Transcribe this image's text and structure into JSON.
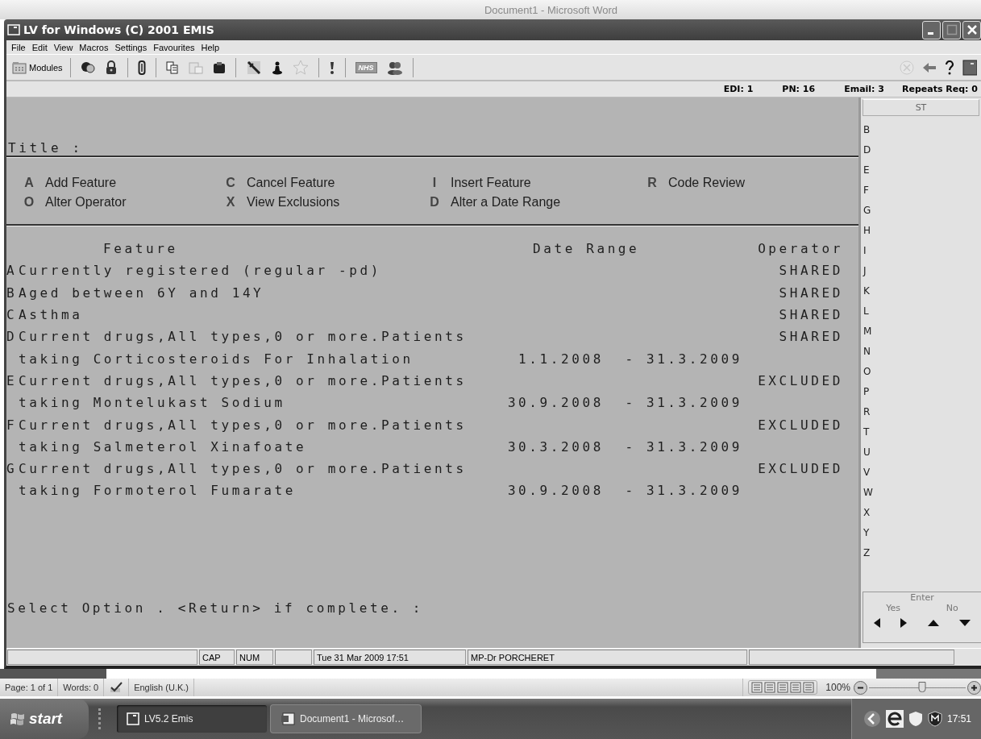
{
  "background_window": {
    "title": "Document1 - Microsoft Word"
  },
  "window": {
    "title": "LV for Windows (C) 2001 EMIS"
  },
  "menu": [
    "File",
    "Edit",
    "View",
    "Macros",
    "Settings",
    "Favourites",
    "Help"
  ],
  "toolbar": {
    "items": [
      {
        "kind": "button",
        "label": "Modules"
      },
      {
        "kind": "separator"
      },
      {
        "kind": "icon",
        "disabled": false
      },
      {
        "kind": "icon",
        "disabled": false
      },
      {
        "kind": "separator"
      },
      {
        "kind": "icon",
        "disabled": false
      },
      {
        "kind": "separator"
      },
      {
        "kind": "icon",
        "disabled": false
      },
      {
        "kind": "icon",
        "disabled": true
      },
      {
        "kind": "icon",
        "disabled": false
      },
      {
        "kind": "separator"
      },
      {
        "kind": "icon",
        "disabled": false
      },
      {
        "kind": "icon",
        "disabled": false
      },
      {
        "kind": "icon",
        "disabled": true
      },
      {
        "kind": "separator"
      },
      {
        "kind": "icon",
        "disabled": false
      },
      {
        "kind": "separator"
      },
      {
        "kind": "badge",
        "label": "NHS",
        "disabled": true
      },
      {
        "kind": "icon",
        "disabled": false
      },
      {
        "kind": "separator"
      }
    ],
    "right": [
      {
        "disabled": true
      },
      {
        "disabled": false
      },
      {
        "disabled": false
      },
      {
        "disabled": false
      }
    ]
  },
  "info_bar": [
    "EDI: 1",
    "PN: 16",
    "Email: 3",
    "Repeats Req: 0"
  ],
  "terminal": {
    "title_label": "Title :",
    "options": [
      {
        "key": "A",
        "label": "Add Feature"
      },
      {
        "key": "C",
        "label": "Cancel Feature"
      },
      {
        "key": "I",
        "label": "Insert Feature"
      },
      {
        "key": "R",
        "label": "Code Review"
      },
      {
        "key": "O",
        "label": "Alter Operator"
      },
      {
        "key": "X",
        "label": "View Exclusions"
      },
      {
        "key": "D",
        "label": "Alter a Date Range"
      }
    ],
    "columns": [
      "Feature",
      "Date Range",
      "Operator"
    ],
    "rows": [
      {
        "letter": "A",
        "feature": "Currently registered (regular -pd)",
        "operator": "SHARED"
      },
      {
        "letter": "B",
        "feature": "Aged between 6Y and 14Y",
        "operator": "SHARED"
      },
      {
        "letter": "C",
        "feature": "Asthma",
        "operator": "SHARED"
      },
      {
        "letter": "D",
        "feature": "Current drugs,All types,0 or more.Patients",
        "detail": "taking Corticosteroids For Inhalation",
        "date_range": "1.1.2008  - 31.3.2009",
        "operator": "SHARED"
      },
      {
        "letter": "E",
        "feature": "Current drugs,All types,0 or more.Patients",
        "detail": "taking Montelukast Sodium",
        "date_range": "30.9.2008  - 31.3.2009",
        "operator": "EXCLUDED"
      },
      {
        "letter": "F",
        "feature": "Current drugs,All types,0 or more.Patients",
        "detail": "taking Salmeterol Xinafoate",
        "date_range": "30.3.2008  - 31.3.2009",
        "operator": "EXCLUDED"
      },
      {
        "letter": "G",
        "feature": "Current drugs,All types,0 or more.Patients",
        "detail": "taking Formoterol Fumarate",
        "date_range": "30.9.2008  - 31.3.2009",
        "operator": "EXCLUDED"
      }
    ],
    "prompt": "Select Option . <Return> if complete. :"
  },
  "sidebar": {
    "header": "ST",
    "letters": [
      "B",
      "D",
      "E",
      "F",
      "G",
      "H",
      "I",
      "J",
      "K",
      "L",
      "M",
      "N",
      "O",
      "P",
      "R",
      "T",
      "U",
      "V",
      "W",
      "X",
      "Y",
      "Z"
    ],
    "enter": {
      "title": "Enter",
      "yes": "Yes",
      "no": "No"
    }
  },
  "status_bar": {
    "caps": "CAP",
    "num": "NUM",
    "datetime": "Tue 31 Mar 2009 17:51",
    "user": "MP-Dr PORCHERET"
  },
  "word_status": {
    "page": "Page: 1 of 1",
    "words": "Words: 0",
    "language": "English (U.K.)",
    "zoom": "100%",
    "zoom_slider": {
      "level": 0.55
    }
  },
  "taskbar": {
    "start": "start",
    "tasks": [
      {
        "label": "LV5.2 Emis",
        "selected": true
      },
      {
        "label": "Document1 - Microsof…",
        "selected": false
      }
    ],
    "clock": "17:51"
  }
}
